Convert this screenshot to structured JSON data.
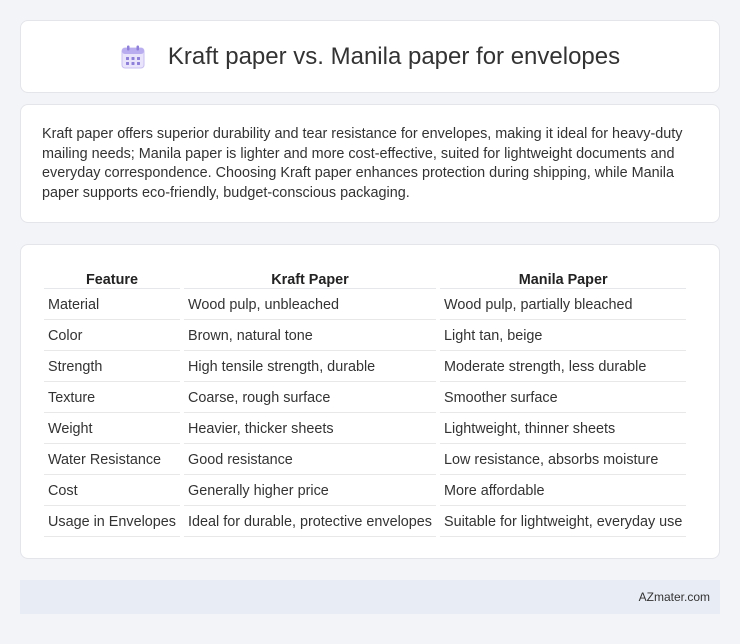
{
  "header": {
    "title": "Kraft paper vs. Manila paper for envelopes",
    "icon": "calendar-icon"
  },
  "summary": {
    "text": "Kraft paper offers superior durability and tear resistance for envelopes, making it ideal for heavy-duty mailing needs; Manila paper is lighter and more cost-effective, suited for lightweight documents and everyday correspondence. Choosing Kraft paper enhances protection during shipping, while Manila paper supports eco-friendly, budget-conscious packaging."
  },
  "table": {
    "headers": [
      "Feature",
      "Kraft Paper",
      "Manila Paper"
    ],
    "rows": [
      [
        "Material",
        "Wood pulp, unbleached",
        "Wood pulp, partially bleached"
      ],
      [
        "Color",
        "Brown, natural tone",
        "Light tan, beige"
      ],
      [
        "Strength",
        "High tensile strength, durable",
        "Moderate strength, less durable"
      ],
      [
        "Texture",
        "Coarse, rough surface",
        "Smoother surface"
      ],
      [
        "Weight",
        "Heavier, thicker sheets",
        "Lightweight, thinner sheets"
      ],
      [
        "Water Resistance",
        "Good resistance",
        "Low resistance, absorbs moisture"
      ],
      [
        "Cost",
        "Generally higher price",
        "More affordable"
      ],
      [
        "Usage in Envelopes",
        "Ideal for durable, protective envelopes",
        "Suitable for lightweight, everyday use"
      ]
    ]
  },
  "footer": {
    "site": "AZmater.com"
  }
}
